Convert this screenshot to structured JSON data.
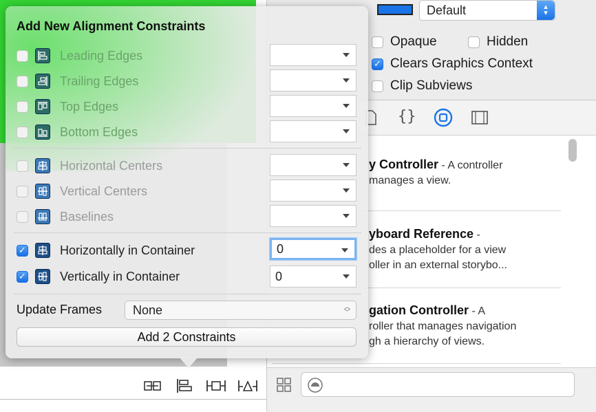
{
  "popover": {
    "title": "Add New Alignment Constraints",
    "rows": [
      {
        "label": "Leading Edges",
        "checked": false,
        "value": "",
        "icon": "leading-edges-icon"
      },
      {
        "label": "Trailing Edges",
        "checked": false,
        "value": "",
        "icon": "trailing-edges-icon"
      },
      {
        "label": "Top Edges",
        "checked": false,
        "value": "",
        "icon": "top-edges-icon"
      },
      {
        "label": "Bottom Edges",
        "checked": false,
        "value": "",
        "icon": "bottom-edges-icon"
      },
      {
        "label": "Horizontal Centers",
        "checked": false,
        "value": "",
        "icon": "horizontal-centers-icon"
      },
      {
        "label": "Vertical Centers",
        "checked": false,
        "value": "",
        "icon": "vertical-centers-icon"
      },
      {
        "label": "Baselines",
        "checked": false,
        "value": "",
        "icon": "baselines-icon"
      },
      {
        "label": "Horizontally in Container",
        "checked": true,
        "value": "0",
        "icon": "horizontally-in-container-icon"
      },
      {
        "label": "Vertically in Container",
        "checked": true,
        "value": "0",
        "icon": "vertically-in-container-icon"
      }
    ],
    "update_frames_label": "Update Frames",
    "update_frames_value": "None",
    "add_button": "Add 2 Constraints"
  },
  "inspector": {
    "background_value": "Default",
    "opaque_label": "Opaque",
    "hidden_label": "Hidden",
    "clears_label": "Clears Graphics Context",
    "clip_label": "Clip Subviews",
    "opaque_checked": false,
    "hidden_checked": false,
    "clears_checked": true,
    "clip_checked": false
  },
  "library": {
    "tabs": [
      "file-template-icon",
      "code-snippet-icon",
      "object-library-icon",
      "media-library-icon"
    ],
    "items": [
      {
        "title": "y Controller",
        "desc1": " - A controller",
        "desc2": "manages a view."
      },
      {
        "title": "yboard Reference",
        "desc1": " -",
        "desc2": "des a placeholder for a view",
        "desc3": "oller in an external storybo..."
      },
      {
        "title": "gation Controller",
        "desc1": " - A",
        "desc2": "roller that manages navigation",
        "desc3": "gh a hierarchy of views."
      }
    ]
  },
  "colors": {
    "view_background": "#33d433",
    "accent": "#1a74e8"
  }
}
